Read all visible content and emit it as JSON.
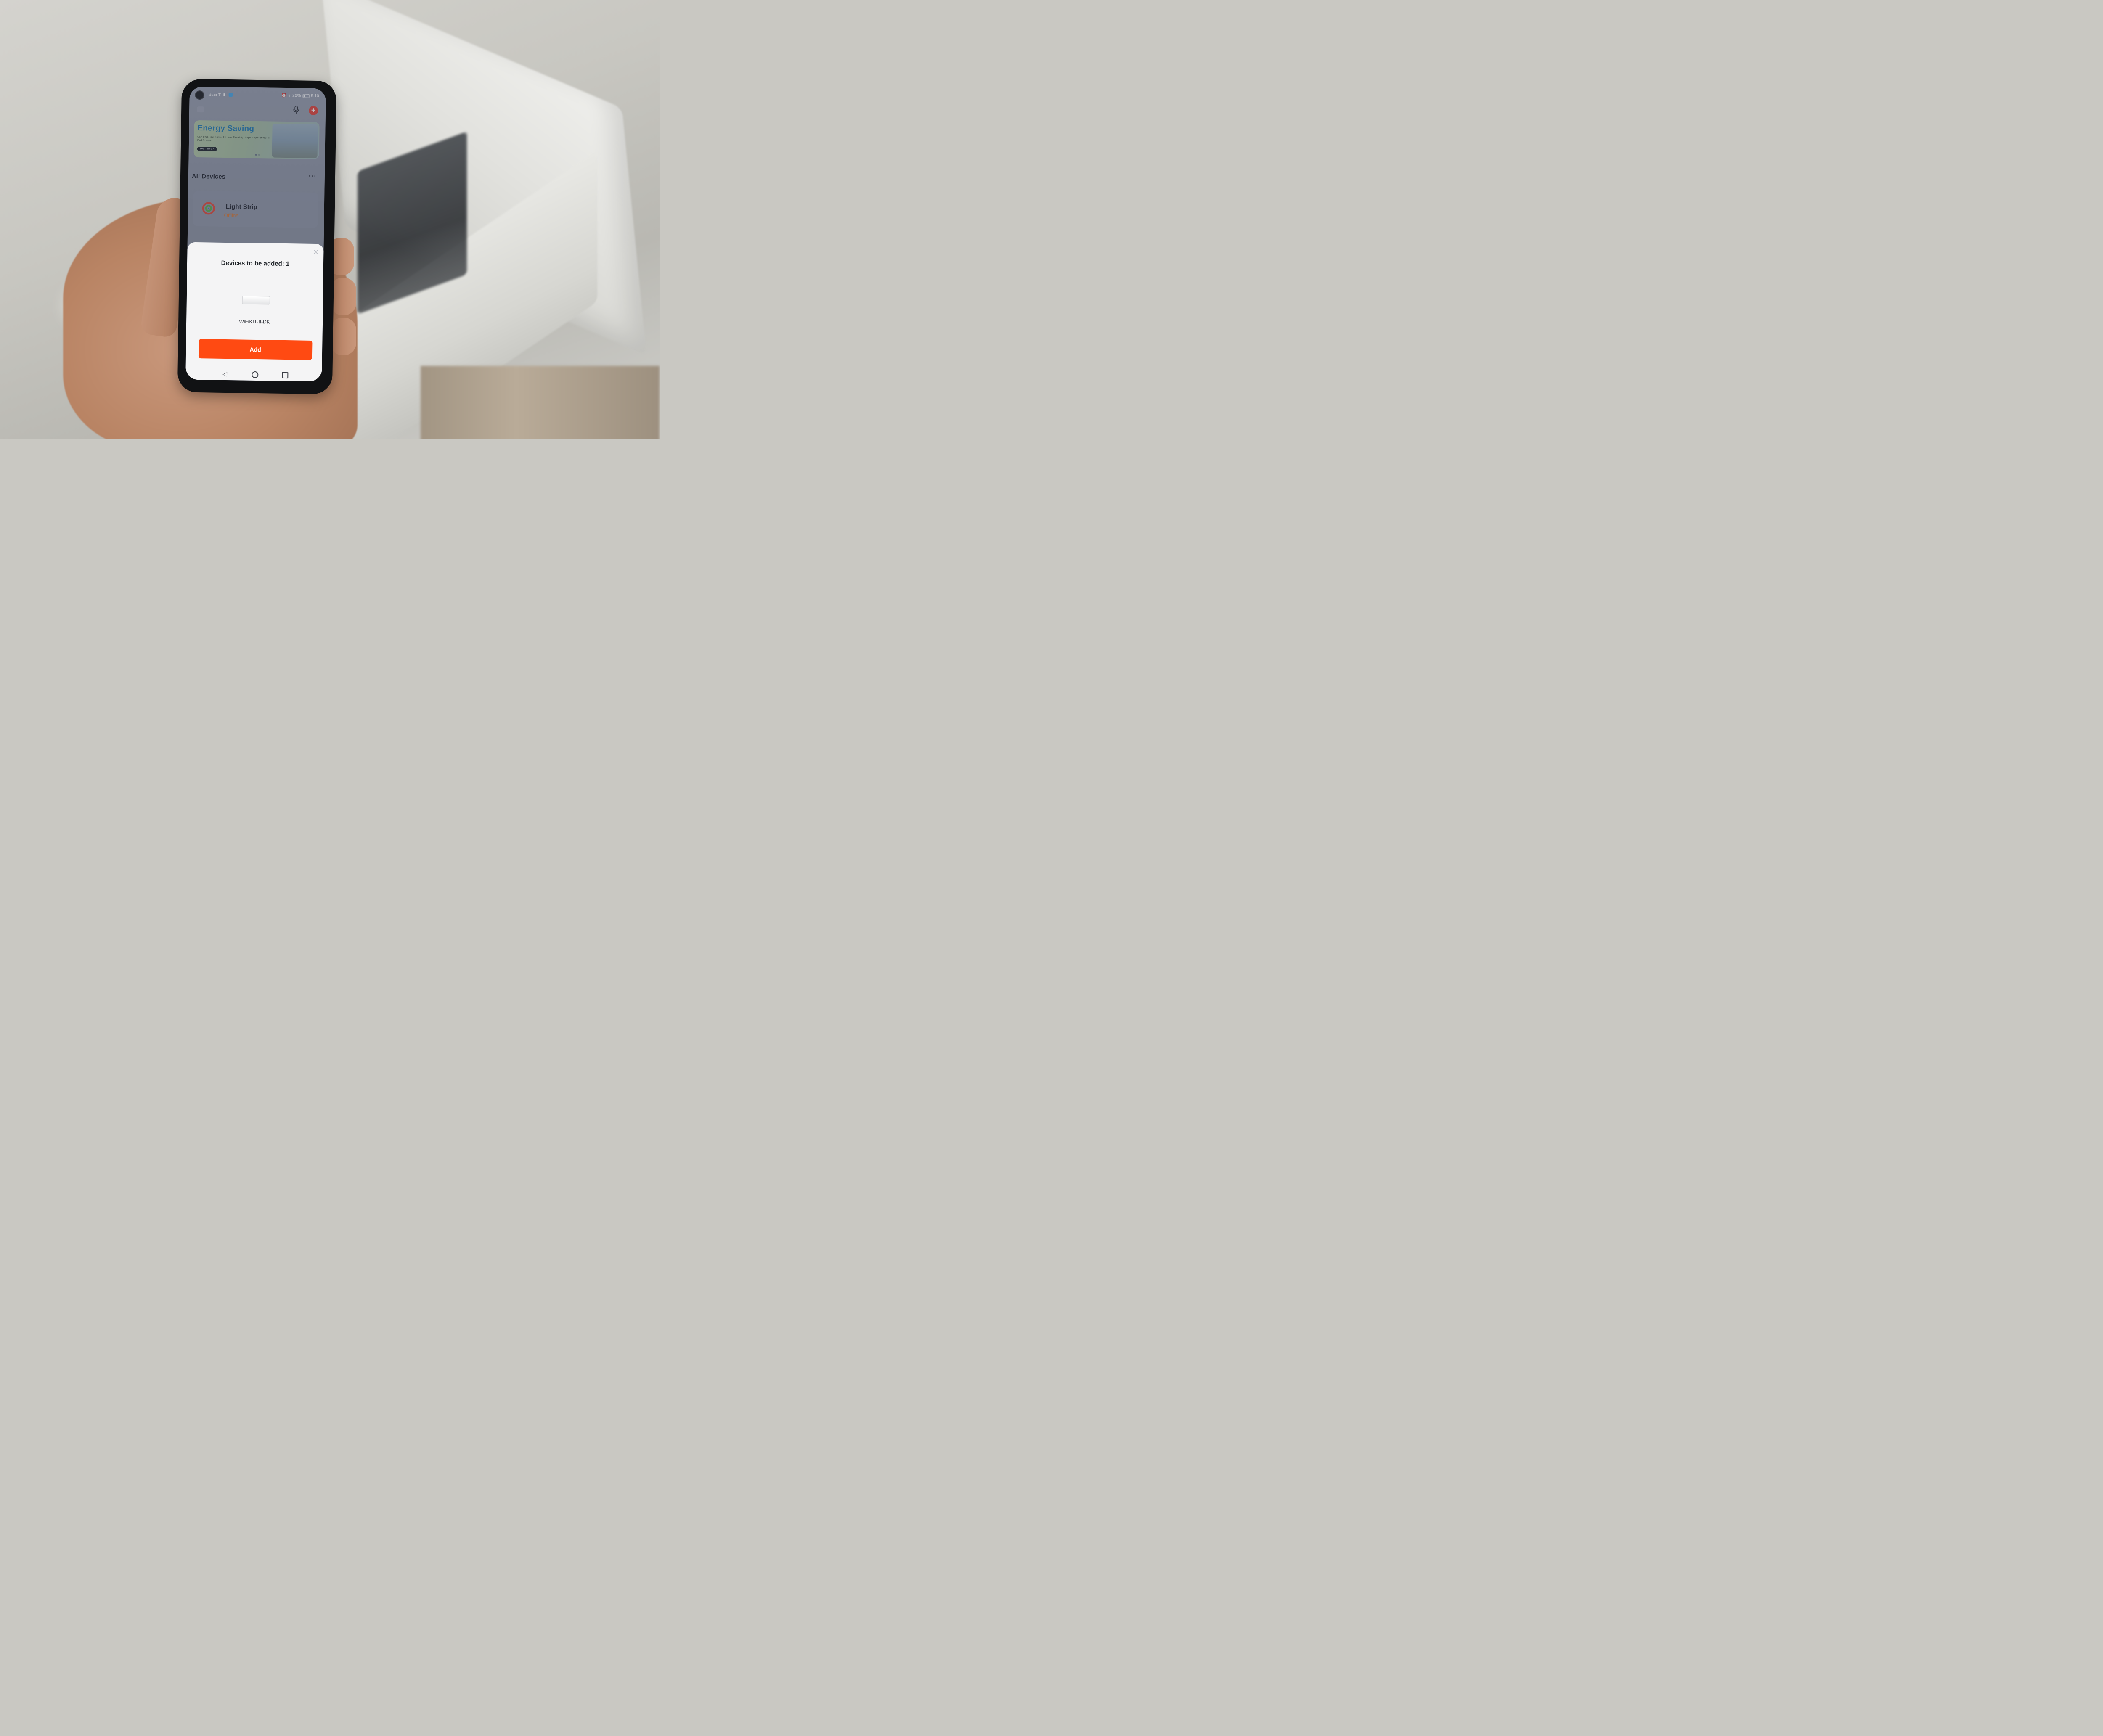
{
  "status_bar": {
    "carrier": "dtac-T",
    "network": "4G",
    "battery": "26%",
    "time": "9:10"
  },
  "banner": {
    "title": "Energy Saving",
    "subtitle": "Gain Real-Time Insights Into Your Electricity Usage. Empower You To Find Savings.",
    "button_label": "Learn more >"
  },
  "devices_section": {
    "title": "All Devices",
    "devices": [
      {
        "name": "Light Strip",
        "status": "Offline"
      }
    ]
  },
  "add_sheet": {
    "title": "Devices to be added: 1",
    "device_name": "WiFiKIT-II-DK",
    "add_label": "Add"
  },
  "colors": {
    "accent": "#ff4a12",
    "offline": "#d97a35",
    "plus_button": "#e5443a",
    "banner_title": "#1f7bb6"
  }
}
